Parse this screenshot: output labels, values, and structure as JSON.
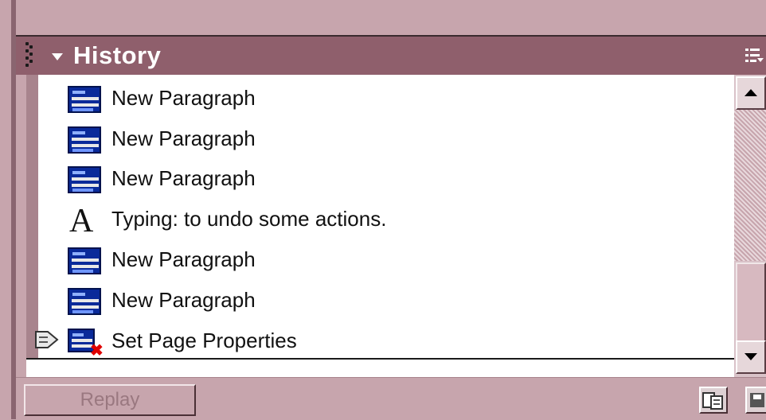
{
  "panel": {
    "title": "History",
    "accent_color": "#8f5f6c",
    "background_color": "#c7a5ad"
  },
  "history": {
    "items": [
      {
        "label": "New Paragraph",
        "icon": "new-paragraph-icon"
      },
      {
        "label": "New Paragraph",
        "icon": "new-paragraph-icon"
      },
      {
        "label": "New Paragraph",
        "icon": "new-paragraph-icon"
      },
      {
        "label": "Typing: to undo some actions.",
        "icon": "typing-icon"
      },
      {
        "label": "New Paragraph",
        "icon": "new-paragraph-icon"
      },
      {
        "label": "New Paragraph",
        "icon": "new-paragraph-icon"
      },
      {
        "label": "Set Page Properties",
        "icon": "page-properties-icon",
        "current": true
      }
    ]
  },
  "buttons": {
    "replay_label": "Replay",
    "copy_icon": "copy-steps-icon",
    "save_icon": "save-command-icon"
  }
}
